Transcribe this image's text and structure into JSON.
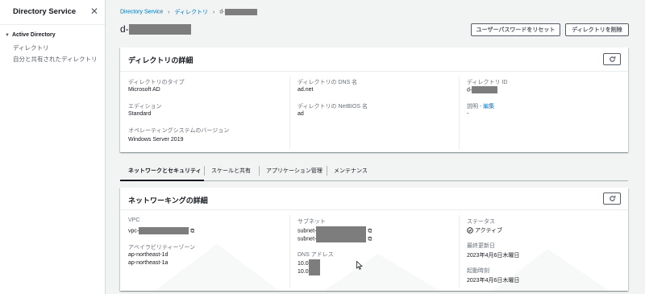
{
  "sidebar": {
    "title": "Directory Service",
    "section": "Active Directory",
    "items": [
      {
        "label": "ディレクトリ"
      },
      {
        "label": "自分と共有されたディレクトリ"
      }
    ]
  },
  "breadcrumb": {
    "items": [
      "Directory Service",
      "ディレクトリ",
      "d-"
    ]
  },
  "page": {
    "title_prefix": "d-"
  },
  "actions": {
    "reset_password": "ユーザーパスワードをリセット",
    "delete": "ディレクトリを削除"
  },
  "details": {
    "title": "ディレクトリの詳細",
    "type_label": "ディレクトリのタイプ",
    "type_value": "Microsoft AD",
    "edition_label": "エディション",
    "edition_value": "Standard",
    "os_label": "オペレーティングシステムのバージョン",
    "os_value": "Windows Server 2019",
    "dns_label": "ディレクトリの DNS 名",
    "dns_value": "ad.net",
    "netbios_label": "ディレクトリの NetBIOS 名",
    "netbios_value": "ad",
    "id_label": "ディレクトリ ID",
    "id_prefix": "d-",
    "desc_label": "説明 - ",
    "desc_edit": "編集",
    "desc_value": "-"
  },
  "tabs": [
    {
      "label": "ネットワークとセキュリティ",
      "active": true
    },
    {
      "label": "スケールと共有"
    },
    {
      "label": "アプリケーション管理"
    },
    {
      "label": "メンテナンス"
    }
  ],
  "networking": {
    "title": "ネットワーキングの詳細",
    "vpc_label": "VPC",
    "vpc_prefix": "vpc-",
    "az_label": "アベイラビリティーゾーン",
    "az_values": [
      "ap-northeast-1d",
      "ap-northeast-1a"
    ],
    "subnet_label": "サブネット",
    "subnet_prefixes": [
      "subnet-",
      "subnet-"
    ],
    "dns_label": "DNS アドレス",
    "dns_prefixes": [
      "10.0",
      "10.0"
    ],
    "status_label": "ステータス",
    "status_value": "アクティブ",
    "updated_label": "最終更新日",
    "updated_value": "2023年4月6日木曜日",
    "launched_label": "起動時刻",
    "launched_value": "2023年4月6日木曜日"
  },
  "colors": {
    "link": "#0073bb",
    "redaction": "#7d7d7d",
    "text": "#16191f",
    "muted": "#687078"
  }
}
